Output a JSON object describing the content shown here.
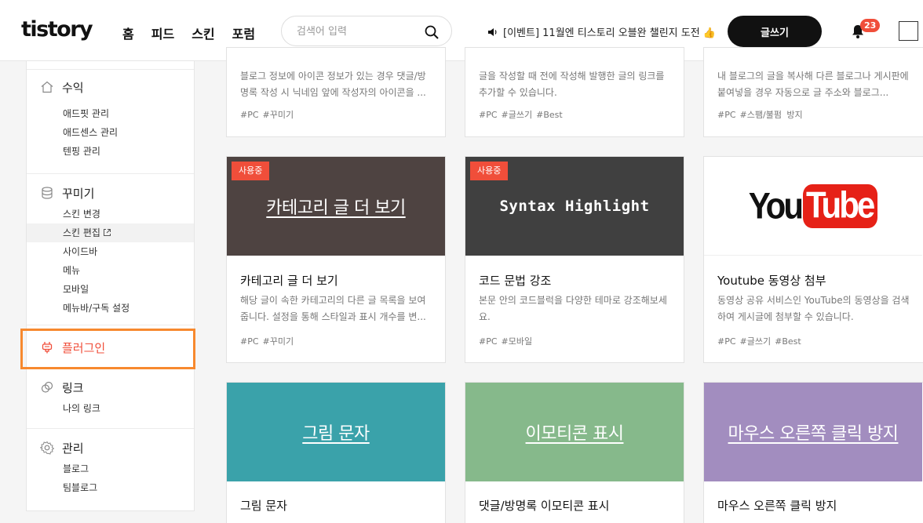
{
  "header": {
    "logo": "tistory",
    "nav": [
      "홈",
      "피드",
      "스킨",
      "포럼"
    ],
    "search_placeholder": "검색어 입력",
    "notice": "[이벤트] 11월엔 티스토리 오블완 챌린지 도전 👍",
    "write_label": "글쓰기",
    "notification_count": "23"
  },
  "sidebar": {
    "sections": [
      {
        "title": "수익",
        "icon": "house-icon",
        "items": [
          "애드핏 관리",
          "애드센스 관리",
          "텐핑 관리"
        ]
      },
      {
        "title": "꾸미기",
        "icon": "palette-icon",
        "items": [
          "스킨 변경",
          "스킨 편집",
          "사이드바",
          "메뉴",
          "모바일",
          "메뉴바/구독 설정"
        ]
      },
      {
        "title": "플러그인",
        "icon": "plug-icon",
        "items": []
      },
      {
        "title": "링크",
        "icon": "link-icon",
        "items": [
          "나의 링크"
        ]
      },
      {
        "title": "관리",
        "icon": "settings-icon",
        "items": [
          "블로그",
          "팀블로그"
        ]
      }
    ],
    "active_item": "스킨 편집",
    "highlighted_section": "플러그인"
  },
  "cards_top": [
    {
      "desc": "블로그 정보에 아이콘 정보가 있는 경우 댓글/방명록 작성 시 닉네임 앞에 작성자의 아이콘을 ...",
      "tags": [
        "#PC",
        "#꾸미기"
      ]
    },
    {
      "desc": "글을 작성할 때 전에 작성해 발행한 글의 링크를 추가할 수 있습니다.",
      "tags": [
        "#PC",
        "#글쓰기",
        "#Best"
      ]
    },
    {
      "desc": "내 블로그의 글을 복사해 다른 블로그나 게시판에 붙여넣을 경우 자동으로 글 주소와 블로그...",
      "tags": [
        "#PC",
        "#스팸/불펌 방지"
      ]
    }
  ],
  "cards_mid": [
    {
      "thumb": "카테고리 글 더 보기",
      "in_use": "사용중",
      "name": "카테고리 글 더 보기",
      "desc": "해당 글이 속한 카테고리의 다른 글 목록을 보여줍니다. 설정을 통해 스타일과 표시 개수를 변...",
      "tags": [
        "#PC",
        "#꾸미기"
      ],
      "color": "#4e4341"
    },
    {
      "thumb": "Syntax Highlight",
      "in_use": "사용중",
      "name": "코드 문법 강조",
      "desc": "본문 안의 코드블럭을 다양한 테마로 강조해보세요.",
      "tags": [
        "#PC",
        "#모바일"
      ],
      "color": "#404040"
    },
    {
      "thumb_you": "You",
      "thumb_tube": "Tube",
      "name": "Youtube 동영상 첨부",
      "desc": "동영상 공유 서비스인 YouTube의 동영상을 검색하여 게시글에 첨부할 수 있습니다.",
      "tags": [
        "#PC",
        "#글쓰기",
        "#Best"
      ],
      "color": "#ffffff"
    }
  ],
  "cards_bottom": [
    {
      "thumb": "그림 문자",
      "name": "그림 문자",
      "color": "#3aa2aa"
    },
    {
      "thumb": "이모티콘 표시",
      "name": "댓글/방명록 이모티콘 표시",
      "color": "#86b98b"
    },
    {
      "thumb": "마우스 오른쪽 클릭 방지",
      "name": "마우스 오른쪽 클릭 방지",
      "color": "#a28dbf"
    }
  ]
}
